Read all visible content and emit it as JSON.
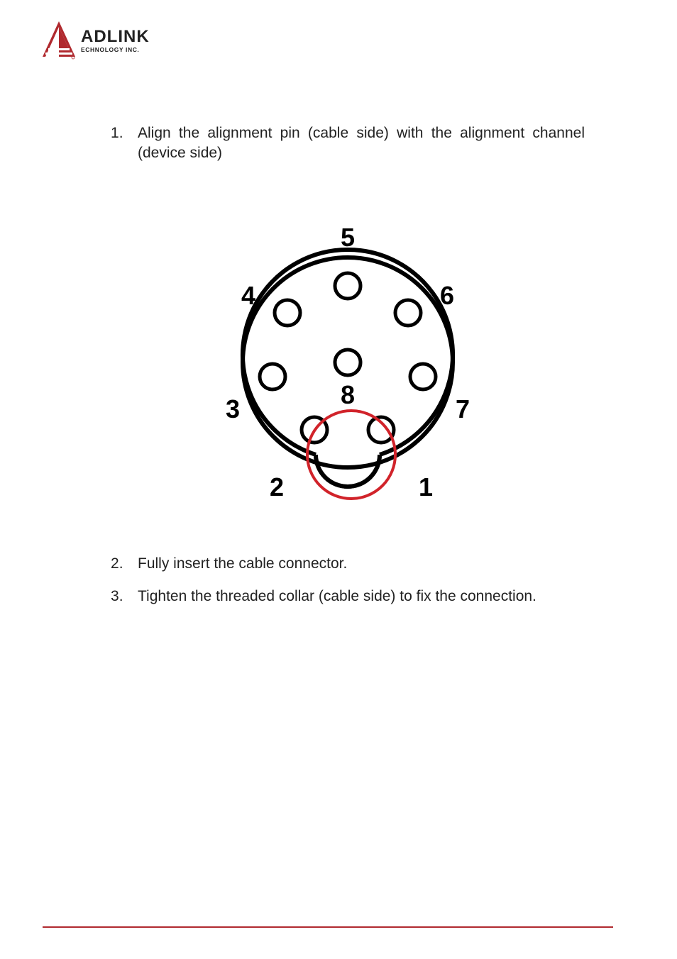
{
  "logo": {
    "main": "ADLINK",
    "sub": "ECHNOLOGY INC."
  },
  "steps": {
    "s1": "Align the alignment pin (cable side) with the alignment channel (device side)",
    "s2": "Fully insert the cable connector.",
    "s3": "Tighten the threaded collar (cable side) to fix the connection."
  },
  "pin_labels": {
    "p1": "1",
    "p2": "2",
    "p3": "3",
    "p4": "4",
    "p5": "5",
    "p6": "6",
    "p7": "7",
    "p8": "8"
  },
  "chart_data": {
    "type": "diagram",
    "description": "8-pin circular connector face view with pins labeled 1–8 and an alignment notch/key at bottom center highlighted in red",
    "pins": [
      1,
      2,
      3,
      4,
      5,
      6,
      7,
      8
    ],
    "highlight": "alignment channel between pins 1 and 2"
  }
}
